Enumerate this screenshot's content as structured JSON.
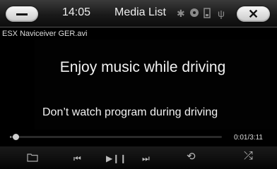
{
  "status_bar": {
    "time": "14:05",
    "title": "Media List",
    "icons": [
      "bluetooth-icon",
      "disc-icon",
      "sd-card-icon",
      "usb-icon"
    ]
  },
  "file_name": "ESX Naviceiver GER.avi",
  "messages": {
    "primary": "Enjoy music while driving",
    "secondary": "Don’t watch program during driving"
  },
  "playback": {
    "position": "0:01",
    "duration": "3:11",
    "time_display": "0:01/3:11",
    "progress_fraction": 0.005
  },
  "controls": [
    "folder-icon",
    "previous-icon",
    "play-pause-icon",
    "next-icon",
    "repeat-icon",
    "shuffle-icon"
  ],
  "colors": {
    "background": "#000000",
    "text": "#ffffff",
    "icon_gray": "#8a8a8a"
  }
}
